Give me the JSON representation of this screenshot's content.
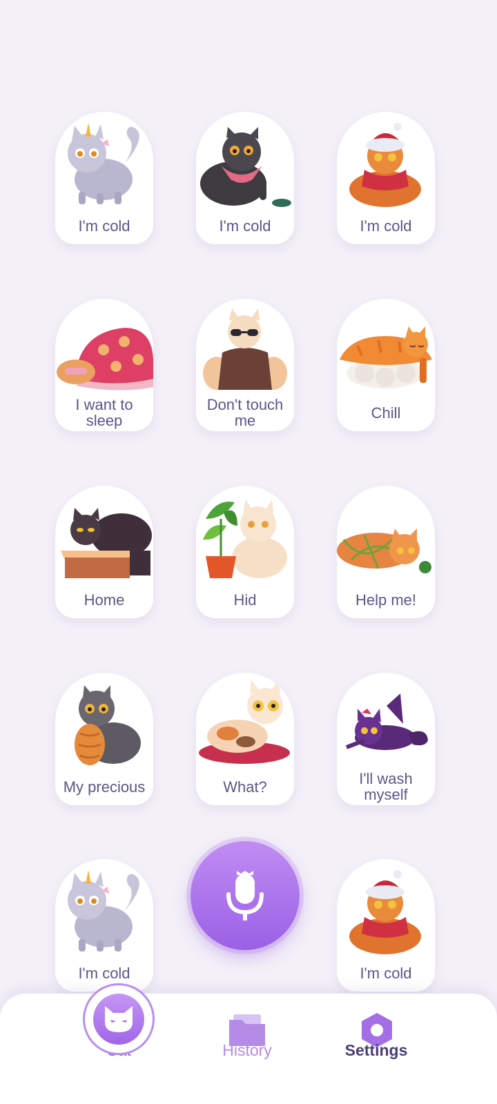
{
  "cards": [
    {
      "label": "I'm cold",
      "art": "grey-unicorn-cat"
    },
    {
      "label": "I'm cold",
      "art": "black-cat-bandana"
    },
    {
      "label": "I'm cold",
      "art": "orange-cat-scarf"
    },
    {
      "label": "I want to sleep",
      "art": "cat-under-blanket"
    },
    {
      "label": "Don't touch me",
      "art": "cat-sunglasses-sweater"
    },
    {
      "label": "Chill",
      "art": "sushi-cat"
    },
    {
      "label": "Home",
      "art": "cat-in-box"
    },
    {
      "label": "Hid",
      "art": "cat-behind-plant"
    },
    {
      "label": "Help me!",
      "art": "cat-tangled-yarn"
    },
    {
      "label": "My precious",
      "art": "cat-hugging-bread"
    },
    {
      "label": "What?",
      "art": "cat-on-cushion"
    },
    {
      "label": "I'll wash myself",
      "art": "purple-cat-licking"
    },
    {
      "label": "I'm cold",
      "art": "grey-unicorn-cat"
    },
    {
      "label": "I'm cold",
      "art": "orange-cat-scarf"
    }
  ],
  "mic_button": {
    "icon": "microphone-icon"
  },
  "nav": {
    "items": [
      {
        "label": "Cat",
        "icon": "cat-face-icon",
        "color": "#9a5fe0",
        "active": true
      },
      {
        "label": "History",
        "icon": "folder-icon",
        "color": "#b48be6",
        "active": false
      },
      {
        "label": "Settings",
        "icon": "hexagon-gear-icon",
        "color": "#4a3f73",
        "active": false
      }
    ]
  },
  "colors": {
    "background": "#f3f0f8",
    "accent": "#9a60e6",
    "label_text": "#5d5588"
  }
}
